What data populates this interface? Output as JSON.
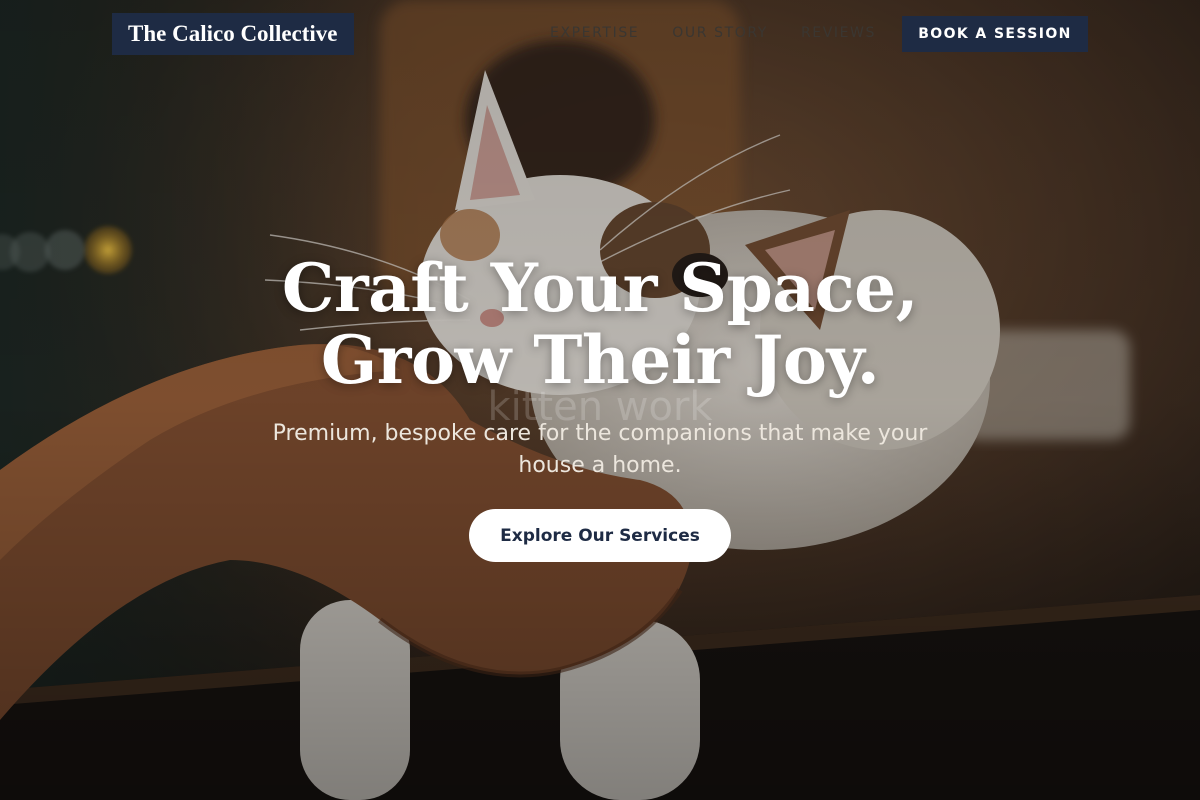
{
  "header": {
    "logo_text": "The Calico Collective",
    "nav": [
      {
        "label": "EXPERTISE"
      },
      {
        "label": "OUR STORY"
      },
      {
        "label": "REVIEWS"
      }
    ],
    "cta_label": "BOOK A SESSION"
  },
  "hero": {
    "headline_line1": "Craft Your Space,",
    "headline_line2": "Grow Their Joy.",
    "watermark": "kitten work",
    "subheading": "Premium, bespoke care for the companions that make your house a home.",
    "cta_label": "Explore Our Services"
  },
  "colors": {
    "brand_navy": "#1e2b44",
    "text_light": "#ffffff",
    "nav_text": "#3a3631"
  }
}
